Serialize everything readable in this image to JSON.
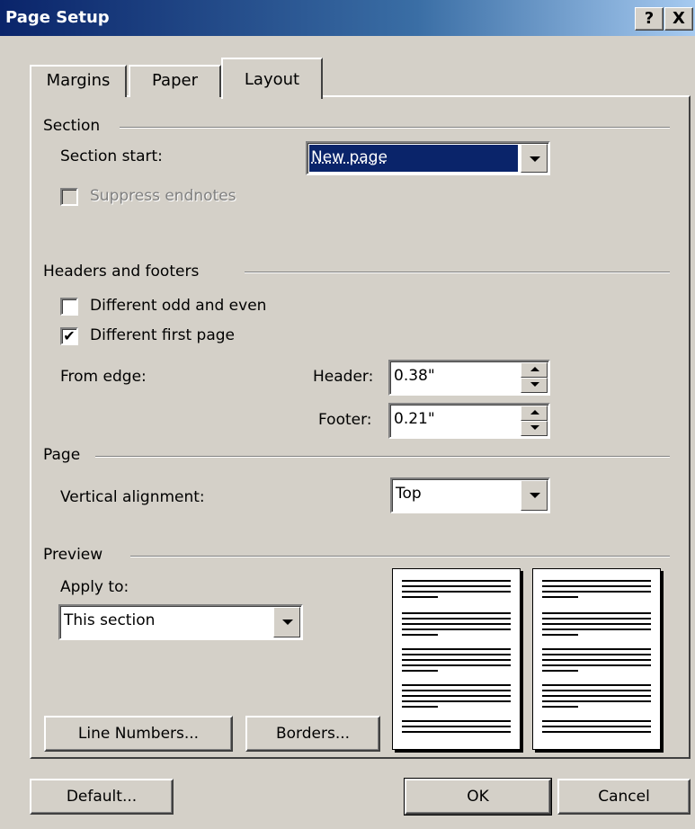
{
  "window": {
    "title": "Page Setup",
    "help_btn": "?",
    "close_btn": "X"
  },
  "tabs": [
    {
      "label": "Margins"
    },
    {
      "label": "Paper"
    },
    {
      "label": "Layout"
    }
  ],
  "section": {
    "heading": "Section",
    "start_label": "Section start:",
    "start_value": "New page",
    "suppress_label": "Suppress endnotes"
  },
  "headers_footers": {
    "heading": "Headers and footers",
    "odd_even_label": "Different odd and even",
    "first_page_label": "Different first page",
    "first_page_checked": "✔",
    "from_edge_label": "From edge:",
    "header_label": "Header:",
    "header_value": "0.38\"",
    "footer_label": "Footer:",
    "footer_value": "0.21\""
  },
  "page": {
    "heading": "Page",
    "valign_label": "Vertical alignment:",
    "valign_value": "Top"
  },
  "preview": {
    "heading": "Preview",
    "apply_label": "Apply to:",
    "apply_value": "This section"
  },
  "buttons": {
    "line_numbers": "Line Numbers...",
    "borders": "Borders...",
    "default": "Default...",
    "ok": "OK",
    "cancel": "Cancel"
  },
  "colors": {
    "title_bar": "#0a246a",
    "face": "#d4d0c8",
    "selection": "#0a246a"
  }
}
